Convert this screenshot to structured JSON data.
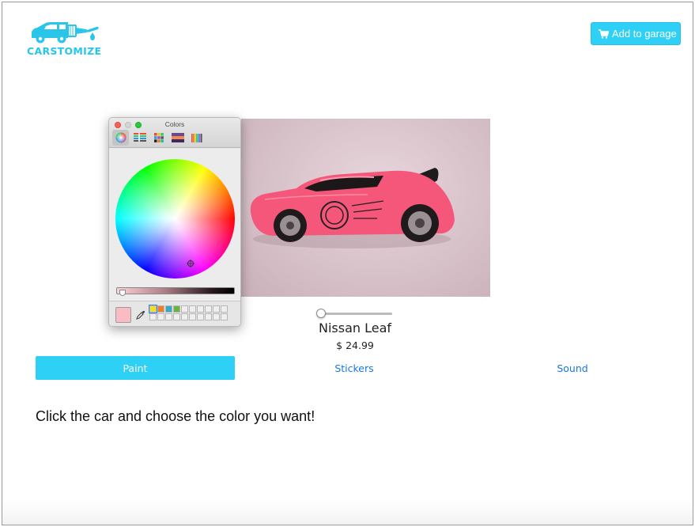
{
  "header": {
    "logo_text": "CARSTOMIZE",
    "add_to_garage_label": "Add to garage"
  },
  "product": {
    "name": "Nissan Leaf",
    "price": "$ 24.99",
    "car_color": "#f4577a"
  },
  "color_picker": {
    "title": "Colors",
    "tabs": [
      "color-wheel",
      "color-sliders",
      "color-palettes",
      "image-palettes",
      "pencils"
    ],
    "active_tab": "color-wheel",
    "current_color": "#f9bcc3",
    "saved_swatches": [
      "#f3e01a",
      "#f07f1f",
      "#34a8cf",
      "#6db33f"
    ]
  },
  "tabs": [
    {
      "label": "Paint",
      "active": true
    },
    {
      "label": "Stickers",
      "active": false
    },
    {
      "label": "Sound",
      "active": false
    }
  ],
  "instructions": "Click the car and choose the color you want!",
  "colors": {
    "accent": "#2fd0f5",
    "link": "#1878e6"
  }
}
